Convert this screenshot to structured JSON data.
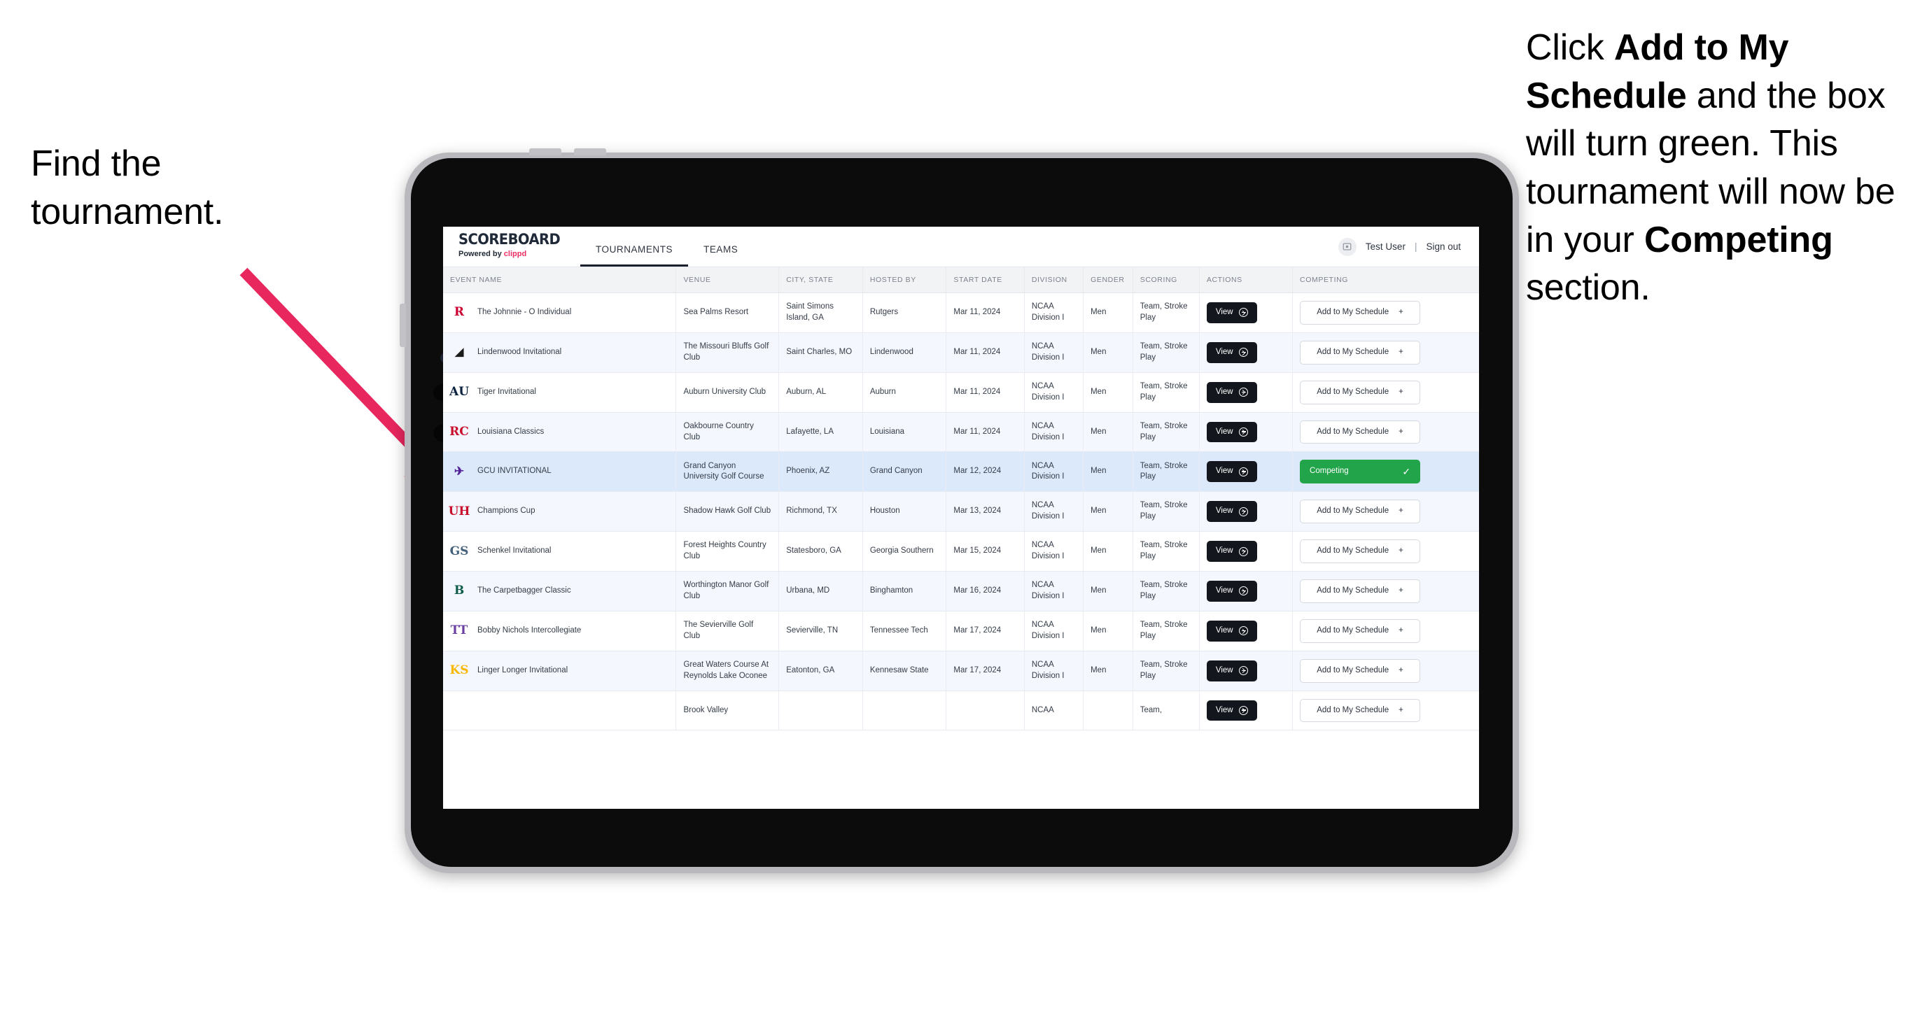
{
  "annotations": {
    "left": {
      "line1": "Find the",
      "line2": "tournament."
    },
    "right": {
      "seg1": "Click ",
      "bold1": "Add to My Schedule",
      "seg2": " and the box will turn green. This tournament will now be in your ",
      "bold2": "Competing",
      "seg3": " section."
    },
    "arrow_color": "#e8275f"
  },
  "app": {
    "brand": {
      "title": "SCOREBOARD",
      "powered_prefix": "Powered by ",
      "powered_name": "clippd"
    },
    "nav": [
      {
        "label": "TOURNAMENTS",
        "active": true
      },
      {
        "label": "TEAMS",
        "active": false
      }
    ],
    "user": {
      "name": "Test User",
      "separator": "|",
      "sign_out": "Sign out",
      "avatar_icon": "user-avatar-icon"
    },
    "table": {
      "columns": [
        "EVENT NAME",
        "VENUE",
        "CITY, STATE",
        "HOSTED BY",
        "START DATE",
        "DIVISION",
        "GENDER",
        "SCORING",
        "ACTIONS",
        "COMPETING"
      ],
      "view_label": "View",
      "add_label": "Add to My Schedule",
      "add_plus": "+",
      "competing_label": "Competing",
      "competing_check": "✓",
      "competing_color": "#22a44a",
      "rows": [
        {
          "event": "The Johnnie - O Individual",
          "venue": "Sea Palms Resort",
          "city": "Saint Simons Island, GA",
          "hosted_by": "Rutgers",
          "start_date": "Mar 11, 2024",
          "division": "NCAA Division I",
          "gender": "Men",
          "scoring": "Team, Stroke Play",
          "competing": false,
          "logo": {
            "text": "R",
            "color": "#cc0033",
            "bg": "transparent"
          }
        },
        {
          "event": "Lindenwood Invitational",
          "venue": "The Missouri Bluffs Golf Club",
          "city": "Saint Charles, MO",
          "hosted_by": "Lindenwood",
          "start_date": "Mar 11, 2024",
          "division": "NCAA Division I",
          "gender": "Men",
          "scoring": "Team, Stroke Play",
          "competing": false,
          "logo": {
            "text": "◢",
            "color": "#1b1b1b",
            "bg": "transparent"
          }
        },
        {
          "event": "Tiger Invitational",
          "venue": "Auburn University Club",
          "city": "Auburn, AL",
          "hosted_by": "Auburn",
          "start_date": "Mar 11, 2024",
          "division": "NCAA Division I",
          "gender": "Men",
          "scoring": "Team, Stroke Play",
          "competing": false,
          "logo": {
            "text": "AU",
            "color": "#0c2340",
            "bg": "transparent"
          }
        },
        {
          "event": "Louisiana Classics",
          "venue": "Oakbourne Country Club",
          "city": "Lafayette, LA",
          "hosted_by": "Louisiana",
          "start_date": "Mar 11, 2024",
          "division": "NCAA Division I",
          "gender": "Men",
          "scoring": "Team, Stroke Play",
          "competing": false,
          "logo": {
            "text": "RC",
            "color": "#c8102e",
            "bg": "transparent"
          }
        },
        {
          "event": "GCU INVITATIONAL",
          "venue": "Grand Canyon University Golf Course",
          "city": "Phoenix, AZ",
          "hosted_by": "Grand Canyon",
          "start_date": "Mar 12, 2024",
          "division": "NCAA Division I",
          "gender": "Men",
          "scoring": "Team, Stroke Play",
          "competing": true,
          "selected": true,
          "logo": {
            "text": "✈",
            "color": "#522398",
            "bg": "transparent"
          }
        },
        {
          "event": "Champions Cup",
          "venue": "Shadow Hawk Golf Club",
          "city": "Richmond, TX",
          "hosted_by": "Houston",
          "start_date": "Mar 13, 2024",
          "division": "NCAA Division I",
          "gender": "Men",
          "scoring": "Team, Stroke Play",
          "competing": false,
          "logo": {
            "text": "UH",
            "color": "#c8102e",
            "bg": "transparent"
          }
        },
        {
          "event": "Schenkel Invitational",
          "venue": "Forest Heights Country Club",
          "city": "Statesboro, GA",
          "hosted_by": "Georgia Southern",
          "start_date": "Mar 15, 2024",
          "division": "NCAA Division I",
          "gender": "Men",
          "scoring": "Team, Stroke Play",
          "competing": false,
          "logo": {
            "text": "GS",
            "color": "#44617b",
            "bg": "transparent"
          }
        },
        {
          "event": "The Carpetbagger Classic",
          "venue": "Worthington Manor Golf Club",
          "city": "Urbana, MD",
          "hosted_by": "Binghamton",
          "start_date": "Mar 16, 2024",
          "division": "NCAA Division I",
          "gender": "Men",
          "scoring": "Team, Stroke Play",
          "competing": false,
          "logo": {
            "text": "B",
            "color": "#0f5c4c",
            "bg": "transparent"
          }
        },
        {
          "event": "Bobby Nichols Intercollegiate",
          "venue": "The Sevierville Golf Club",
          "city": "Sevierville, TN",
          "hosted_by": "Tennessee Tech",
          "start_date": "Mar 17, 2024",
          "division": "NCAA Division I",
          "gender": "Men",
          "scoring": "Team, Stroke Play",
          "competing": false,
          "logo": {
            "text": "TT",
            "color": "#6b3fa0",
            "bg": "transparent"
          }
        },
        {
          "event": "Linger Longer Invitational",
          "venue": "Great Waters Course At Reynolds Lake Oconee",
          "city": "Eatonton, GA",
          "hosted_by": "Kennesaw State",
          "start_date": "Mar 17, 2024",
          "division": "NCAA Division I",
          "gender": "Men",
          "scoring": "Team, Stroke Play",
          "competing": false,
          "logo": {
            "text": "KS",
            "color": "#f8b800",
            "bg": "transparent"
          }
        },
        {
          "event": "",
          "venue": "Brook Valley",
          "city": "",
          "hosted_by": "",
          "start_date": "",
          "division": "NCAA",
          "gender": "",
          "scoring": "Team,",
          "competing": false,
          "clipped": true,
          "logo": {
            "text": "",
            "color": "#6b3fa0",
            "bg": "transparent"
          }
        }
      ]
    }
  }
}
